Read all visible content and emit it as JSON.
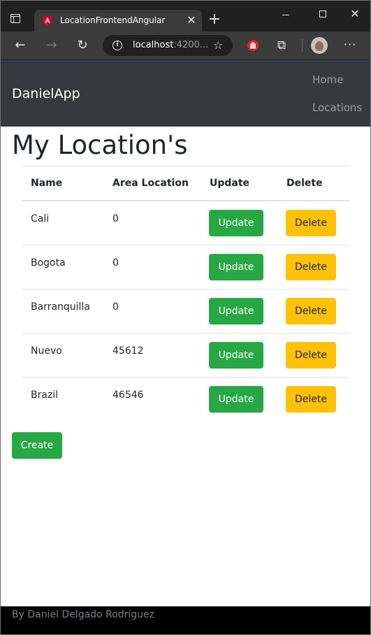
{
  "browser": {
    "tab_title": "LocationFrontendAngular",
    "url_host": "localhost",
    "url_rest": ":4200...",
    "new_tab_symbol": "+",
    "close_symbol": "✕"
  },
  "navbar": {
    "brand": "DanielApp",
    "links": [
      {
        "label": "Home"
      },
      {
        "label": "Locations"
      }
    ]
  },
  "page": {
    "title": "My Location's"
  },
  "table": {
    "headers": [
      "Name",
      "Area Location",
      "Update",
      "Delete"
    ],
    "rows": [
      {
        "name": "Cali",
        "area": "0",
        "update_label": "Update",
        "delete_label": "Delete"
      },
      {
        "name": "Bogota",
        "area": "0",
        "update_label": "Update",
        "delete_label": "Delete"
      },
      {
        "name": "Barranquilla",
        "area": "0",
        "update_label": "Update",
        "delete_label": "Delete"
      },
      {
        "name": "Nuevo",
        "area": "45612",
        "update_label": "Update",
        "delete_label": "Delete"
      },
      {
        "name": "Brazil",
        "area": "46546",
        "update_label": "Update",
        "delete_label": "Delete"
      }
    ]
  },
  "actions": {
    "create_label": "Create"
  },
  "footer": {
    "text": "By Daniel Delgado Rodríguez"
  },
  "colors": {
    "navbar_bg": "#343a40",
    "success": "#28a745",
    "warning": "#ffc107",
    "footer_bg": "#000000"
  },
  "icons": {
    "tab_favicon": "angular-logo-icon",
    "info": "info-icon",
    "favorites": "star-add-icon",
    "extension": "hand-stop-icon",
    "extensions_menu": "puzzle-icon",
    "menu": "more-icon"
  }
}
